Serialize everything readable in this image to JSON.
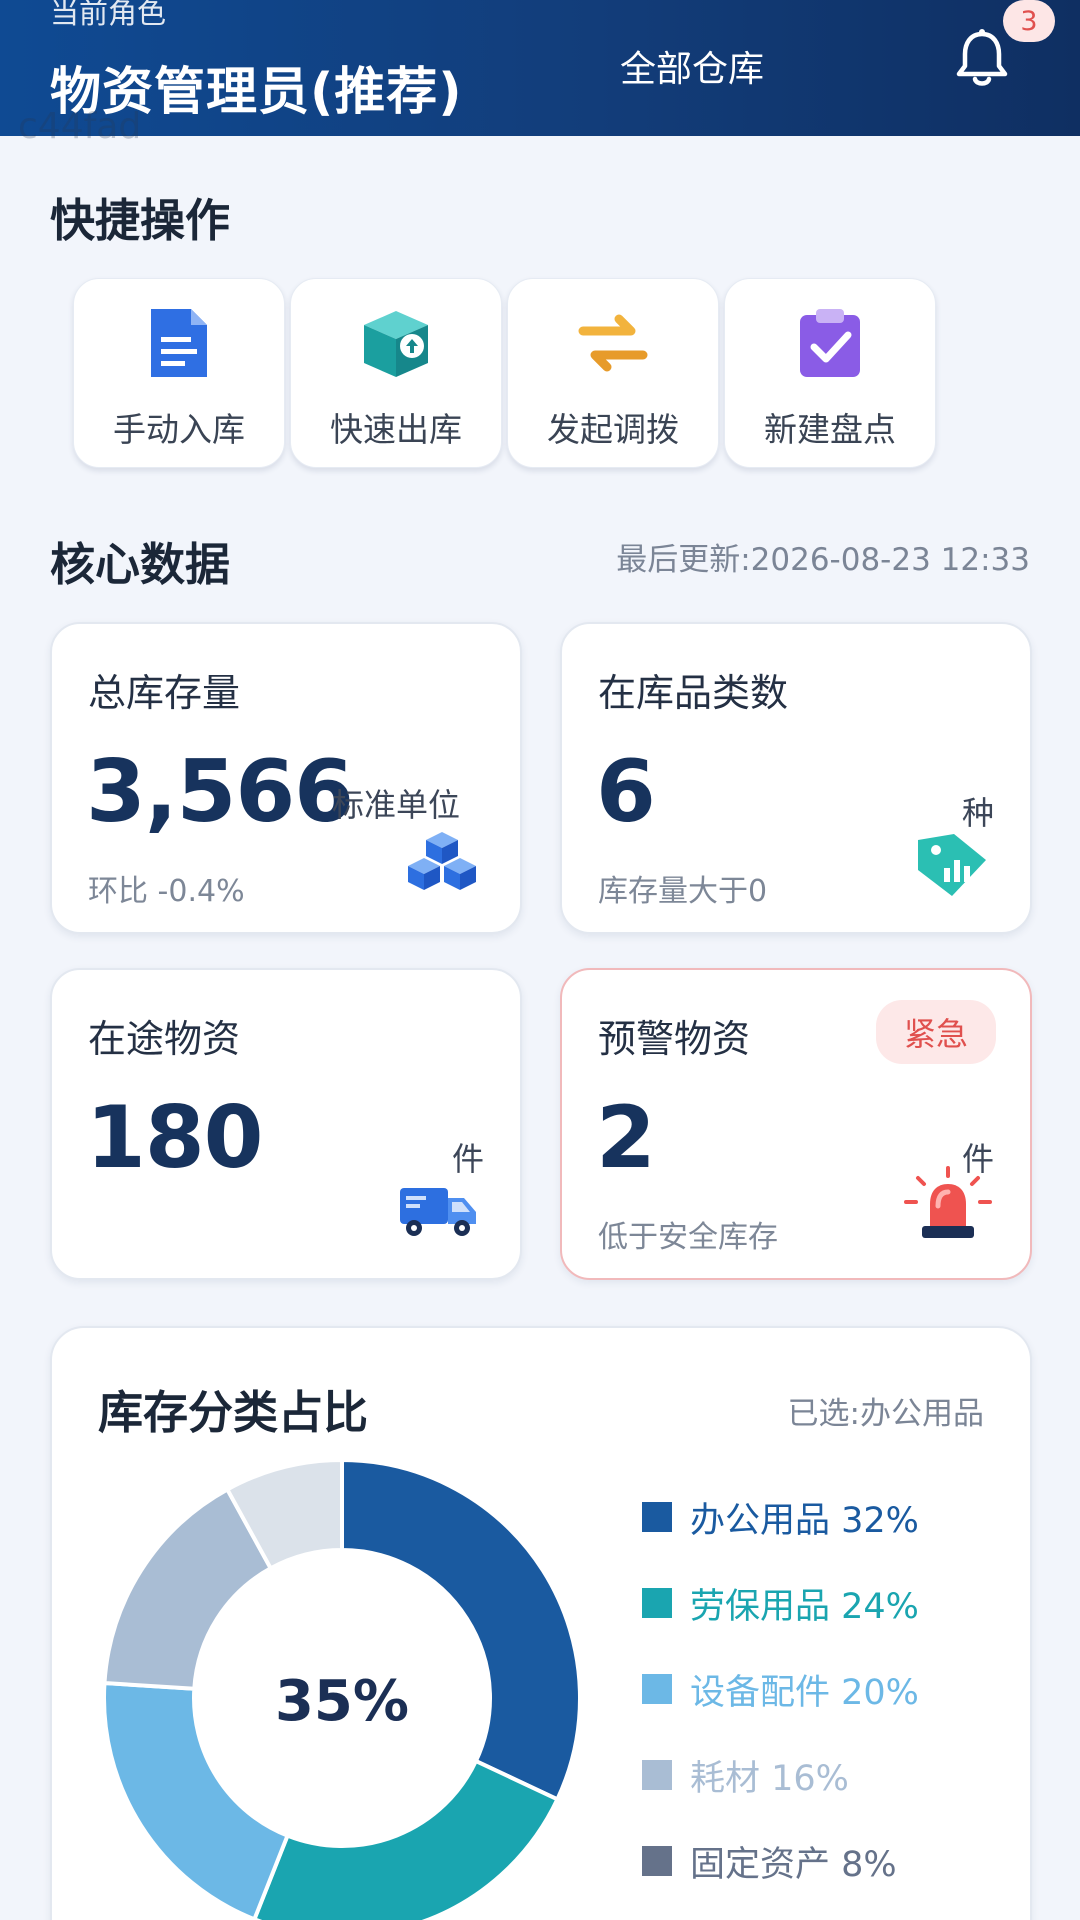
{
  "header": {
    "role_label": "当前角色",
    "role_name": "物资管理员(推荐)",
    "warehouse": "全部仓库",
    "notification_count": "3",
    "watermark": "c44fad"
  },
  "quick_actions": {
    "title": "快捷操作",
    "items": [
      {
        "label": "手动入库",
        "icon": "document-icon"
      },
      {
        "label": "快速出库",
        "icon": "box-out-icon"
      },
      {
        "label": "发起调拨",
        "icon": "transfer-arrows-icon"
      },
      {
        "label": "新建盘点",
        "icon": "clipboard-check-icon"
      }
    ]
  },
  "core_data": {
    "title": "核心数据",
    "updated": "最后更新:2026-08-23 12:33",
    "cards": [
      {
        "title": "总库存量",
        "value": "3,566",
        "unit": "标准单位",
        "sub": "环比 -0.4%",
        "icon": "cubes-icon"
      },
      {
        "title": "在库品类数",
        "value": "6",
        "unit": "种",
        "sub": "库存量大于0",
        "icon": "tag-chart-icon"
      },
      {
        "title": "在途物资",
        "value": "180",
        "unit": "件",
        "sub": "",
        "icon": "truck-icon"
      },
      {
        "title": "预警物资",
        "value": "2",
        "unit": "件",
        "sub": "低于安全库存",
        "badge": "紧急",
        "icon": "alarm-light-icon"
      }
    ]
  },
  "category_share": {
    "title": "库存分类占比",
    "selected": "已选:办公用品",
    "center_label": "35%",
    "legend": [
      {
        "label": "办公用品 32%",
        "color": "#1a5aa0"
      },
      {
        "label": "劳保用品 24%",
        "color": "#1aa5b0"
      },
      {
        "label": "设备配件 20%",
        "color": "#6cb8e6"
      },
      {
        "label": "耗材 16%",
        "color": "#a9bdd4"
      },
      {
        "label": "固定资产 8%",
        "color": "#65728a"
      }
    ]
  },
  "chart_data": {
    "type": "pie",
    "title": "库存分类占比",
    "categories": [
      "办公用品",
      "劳保用品",
      "设备配件",
      "耗材",
      "固定资产"
    ],
    "values": [
      32,
      24,
      20,
      16,
      8
    ],
    "donut": true,
    "colors": [
      "#1a5aa0",
      "#1aa5b0",
      "#6cb8e6",
      "#a9bdd4",
      "#dbe2ea"
    ],
    "center_label": "35%",
    "legend_position": "right"
  }
}
